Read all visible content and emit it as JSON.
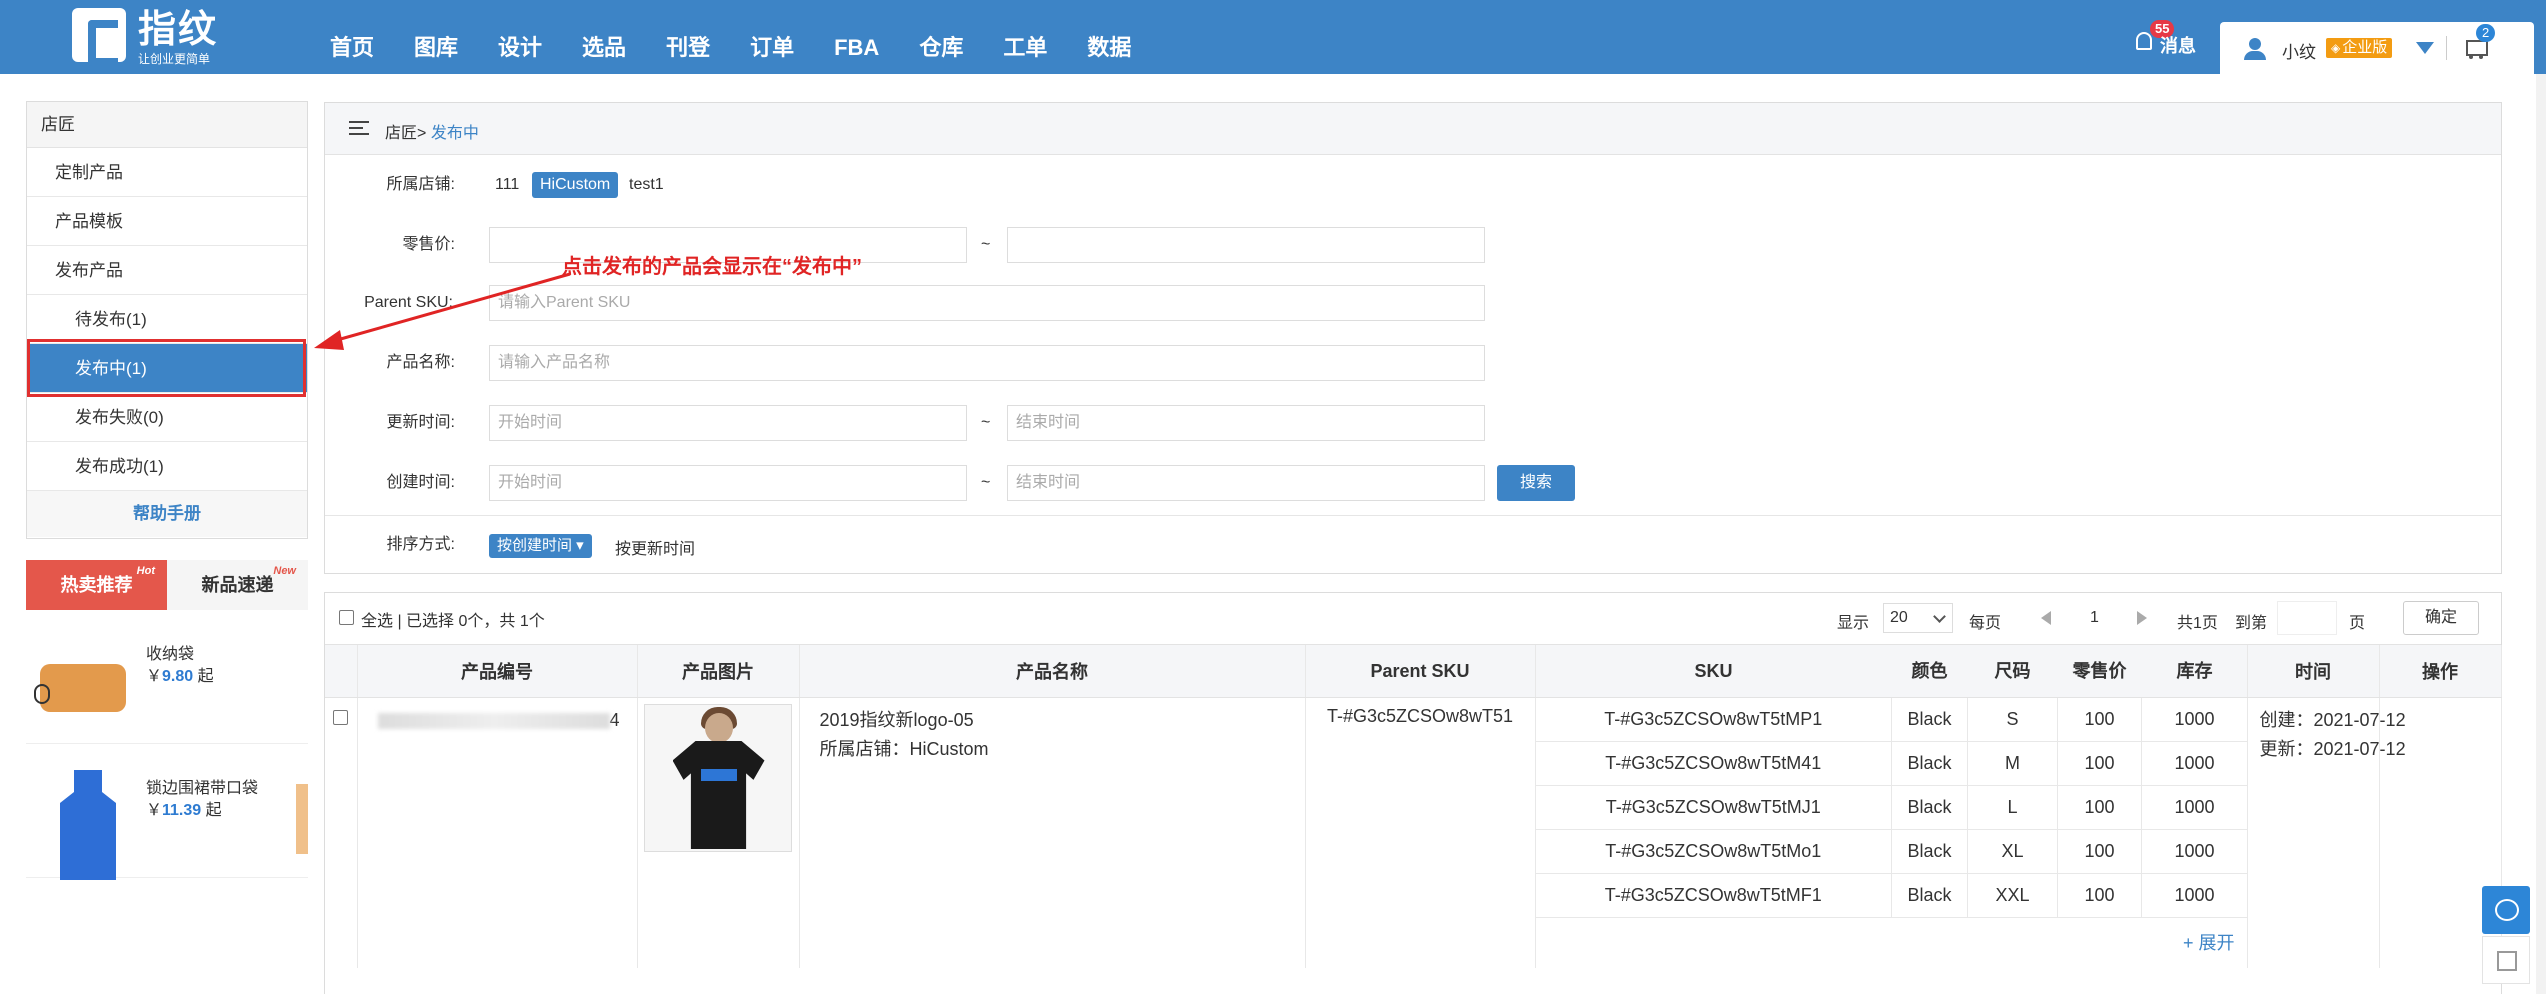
{
  "brand": {
    "name": "指纹",
    "slogan": "让创业更简单"
  },
  "nav": [
    "首页",
    "图库",
    "设计",
    "选品",
    "刊登",
    "订单",
    "FBA",
    "仓库",
    "工单",
    "数据"
  ],
  "header": {
    "message_label": "消息",
    "message_count": "55",
    "user_name": "小纹",
    "enterprise_label": "企业版",
    "cart_count": "2"
  },
  "sidebar": {
    "title": "店匠",
    "items": [
      {
        "label": "定制产品"
      },
      {
        "label": "产品模板"
      },
      {
        "label": "发布产品"
      },
      {
        "label": "待发布(1)"
      },
      {
        "label": "发布中(1)"
      },
      {
        "label": "发布失败(0)"
      },
      {
        "label": "发布成功(1)"
      }
    ],
    "help": "帮助手册"
  },
  "hot": {
    "tabs": [
      {
        "label": "热卖推荐",
        "sup": "Hot"
      },
      {
        "label": "新品速递",
        "sup": "New"
      }
    ],
    "items": [
      {
        "name": "收纳袋",
        "currency": "￥",
        "price": "9.80",
        "suffix": "起"
      },
      {
        "name": "锁边围裙带口袋",
        "currency": "￥",
        "price": "11.39",
        "suffix": "起"
      }
    ]
  },
  "breadcrumb": {
    "parent": "店匠>",
    "current": "发布中"
  },
  "filters": {
    "store_label": "所属店铺:",
    "stores": [
      "111",
      "HiCustom",
      "test1"
    ],
    "price_label": "零售价:",
    "parent_sku_label": "Parent SKU:",
    "parent_sku_placeholder": "请输入Parent SKU",
    "name_label": "产品名称:",
    "name_placeholder": "请输入产品名称",
    "update_label": "更新时间:",
    "create_label": "创建时间:",
    "start_placeholder": "开始时间",
    "end_placeholder": "结束时间",
    "tilde": "~",
    "search_btn": "搜索",
    "sort_label": "排序方式:",
    "sort_active": "按创建时间",
    "sort_other": "按更新时间"
  },
  "annotation": "点击发布的产品会显示在“发布中”",
  "results": {
    "select_text": "全选 | 已选择 0个，共 1个",
    "show_label": "显示",
    "page_size": "20",
    "per_page": "每页",
    "current_page": "1",
    "total_pages": "共1页",
    "goto_label": "到第",
    "page_unit": "页",
    "confirm": "确定"
  },
  "table": {
    "headers": [
      "产品编号",
      "产品图片",
      "产品名称",
      "Parent SKU",
      "SKU",
      "颜色",
      "尺码",
      "零售价",
      "库存",
      "时间",
      "操作"
    ],
    "row": {
      "code_tail": "4",
      "name": "2019指纹新logo-05",
      "store": "所属店铺：HiCustom",
      "parent_sku": "T-#G3c5ZCSOw8wT51",
      "created": "创建：2021-07-12",
      "updated": "更新：2021-07-12",
      "expand": "+ 展开",
      "variants": [
        {
          "sku": "T-#G3c5ZCSOw8wT5tMP1",
          "color": "Black",
          "size": "S",
          "price": "100",
          "stock": "1000"
        },
        {
          "sku": "T-#G3c5ZCSOw8wT5tM41",
          "color": "Black",
          "size": "M",
          "price": "100",
          "stock": "1000"
        },
        {
          "sku": "T-#G3c5ZCSOw8wT5tMJ1",
          "color": "Black",
          "size": "L",
          "price": "100",
          "stock": "1000"
        },
        {
          "sku": "T-#G3c5ZCSOw8wT5tMo1",
          "color": "Black",
          "size": "XL",
          "price": "100",
          "stock": "1000"
        },
        {
          "sku": "T-#G3c5ZCSOw8wT5tMF1",
          "color": "Black",
          "size": "XXL",
          "price": "100",
          "stock": "1000"
        }
      ]
    }
  }
}
